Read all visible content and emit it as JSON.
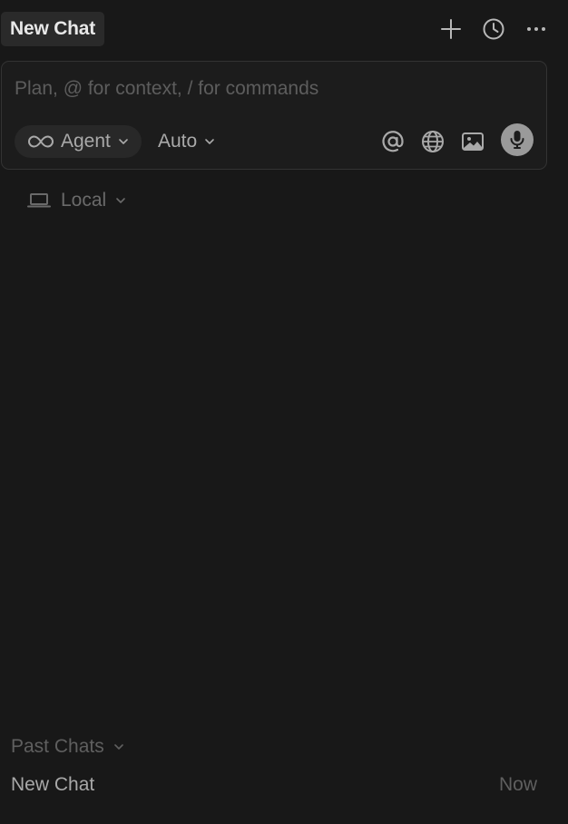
{
  "header": {
    "tab_label": "New Chat",
    "icons": [
      "plus-icon",
      "history-icon",
      "more-icon"
    ]
  },
  "composer": {
    "placeholder": "Plan, @ for context, / for commands",
    "value": "",
    "mode_label": "Agent",
    "model_label": "Auto",
    "icons": [
      "infinity-icon",
      "at-icon",
      "globe-icon",
      "image-icon",
      "microphone-icon"
    ]
  },
  "environment": {
    "label": "Local",
    "icon": "laptop-icon"
  },
  "past_chats": {
    "header_label": "Past Chats",
    "items": [
      {
        "title": "New Chat",
        "time": "Now"
      }
    ]
  },
  "colors": {
    "background": "#181818",
    "panel": "#1c1c1c",
    "border": "#333333",
    "pill": "#282828",
    "text_primary": "#e8e8e8",
    "text_secondary": "#a9a9a9",
    "text_muted": "#5f5f5f",
    "mic_button": "#9a9a9a"
  }
}
